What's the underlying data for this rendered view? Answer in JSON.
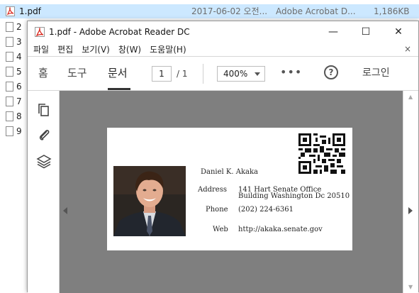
{
  "explorer": {
    "selected_file": {
      "name": "1.pdf",
      "modified": "2017-06-02 오전...",
      "type": "Adobe Acrobat D...",
      "size": "1,186KB"
    },
    "other_files": [
      "2",
      "3",
      "4",
      "5",
      "6",
      "7",
      "8",
      "9"
    ]
  },
  "window": {
    "title": "1.pdf - Adobe Acrobat Reader DC",
    "minimize_label": "—",
    "maximize_label": "☐",
    "close_label": "✕"
  },
  "menu": {
    "items": [
      "파일",
      "편집",
      "보기(V)",
      "창(W)",
      "도움말(H)"
    ],
    "close_label": "×"
  },
  "toolbar": {
    "tabs": [
      "홈",
      "도구",
      "문서"
    ],
    "active_tab": "문서",
    "page_current": "1",
    "page_total": "/ 1",
    "zoom": "400%",
    "more_label": "•••",
    "help_label": "?",
    "login_label": "로그인"
  },
  "card": {
    "name": "Daniel K. Akaka",
    "address_label": "Address",
    "address_line1": "141 Hart Senate Office",
    "address_line2": "Building Washington Dc 20510",
    "phone_label": "Phone",
    "phone": "(202) 224-6361",
    "web_label": "Web",
    "web": "http://akaka.senate.gov"
  },
  "colors": {
    "selection": "#cce8ff",
    "canvas": "#7f7f7f",
    "pdf_red": "#d9261c"
  }
}
